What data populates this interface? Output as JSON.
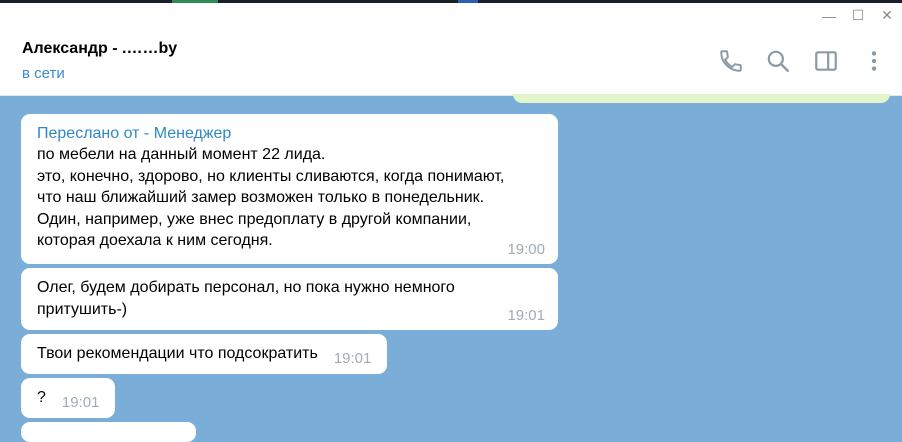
{
  "window": {
    "minimize_glyph": "—",
    "maximize_glyph": "☐",
    "close_glyph": "✕"
  },
  "header": {
    "chat_name": "Александр - .……by",
    "status": "в сети",
    "icons": [
      "phone-icon",
      "search-icon",
      "sidebar-toggle-icon",
      "more-vertical-icon"
    ]
  },
  "messages": [
    {
      "forwarded_from": "Переслано от       - Менеджер",
      "text": "по мебели на данный момент 22 лида.\nэто, конечно, здорово, но клиенты сливаются, когда понимают,\nчто наш ближайший замер возможен только в понедельник.\nОдин, например, уже внес предоплату в другой компании,\nкоторая доехала к ним сегодня.",
      "time": "19:00"
    },
    {
      "text": "Олег, будем добирать персонал, но пока нужно немного\nпритушить-)",
      "time": "19:01"
    },
    {
      "text": "Твои рекомендации что подсократить",
      "time": "19:01"
    },
    {
      "text": "?",
      "time": "19:01"
    }
  ],
  "colors": {
    "chat_bg": "#7aaed8",
    "accent": "#3a8bc9",
    "outgoing_bubble": "#e1f5c8",
    "incoming_bubble": "#ffffff"
  }
}
